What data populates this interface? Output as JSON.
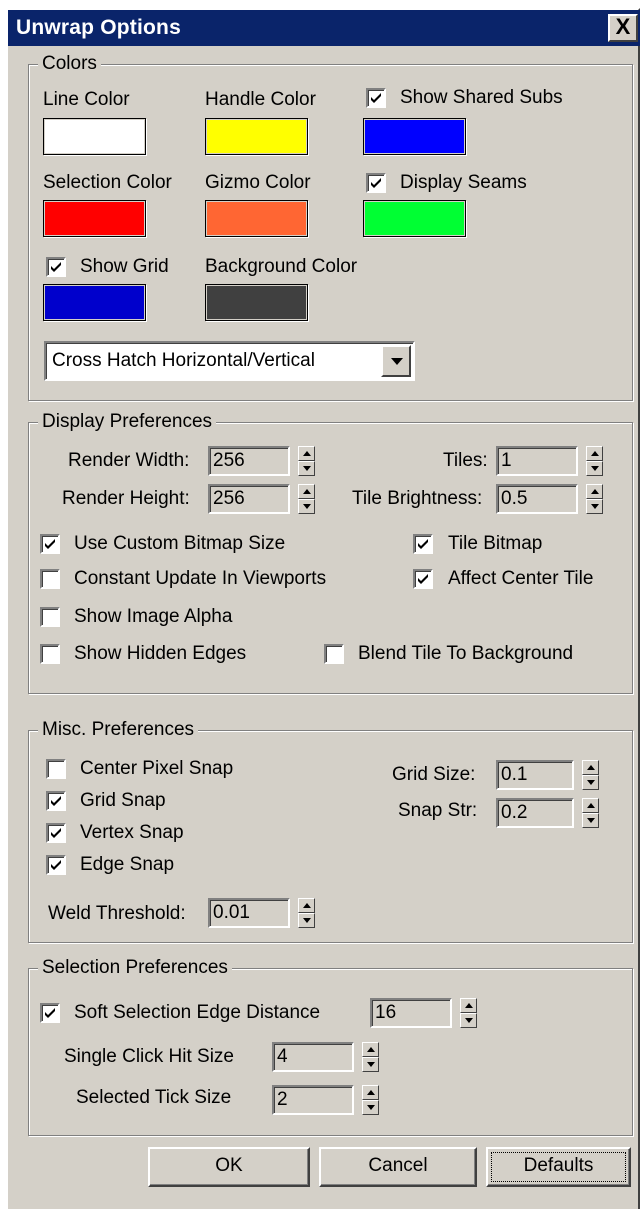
{
  "window": {
    "title": "Unwrap Options",
    "close_glyph": "X"
  },
  "colors": {
    "legend": "Colors",
    "line_color": {
      "label": "Line Color",
      "value": "#ffffff"
    },
    "handle_color": {
      "label": "Handle Color",
      "value": "#ffff00"
    },
    "show_shared_subs": {
      "label": "Show Shared Subs",
      "checked": true,
      "color": "#0000ff"
    },
    "selection_color": {
      "label": "Selection Color",
      "value": "#ff0000"
    },
    "gizmo_color": {
      "label": "Gizmo Color",
      "value": "#ff6633"
    },
    "display_seams": {
      "label": "Display Seams",
      "checked": true,
      "color": "#00ff33"
    },
    "show_grid": {
      "label": "Show Grid",
      "checked": true,
      "color": "#0000cc"
    },
    "background_color": {
      "label": "Background Color",
      "value": "#404040"
    },
    "fill_mode": {
      "value": "Cross Hatch Horizontal/Vertical"
    }
  },
  "display_preferences": {
    "legend": "Display Preferences",
    "render_width": {
      "label": "Render Width:",
      "value": "256"
    },
    "render_height": {
      "label": "Render Height:",
      "value": "256"
    },
    "tiles": {
      "label": "Tiles:",
      "value": "1"
    },
    "tile_brightness": {
      "label": "Tile Brightness:",
      "value": "0.5"
    },
    "use_custom_bitmap_size": {
      "label": "Use Custom Bitmap Size",
      "checked": true
    },
    "constant_update": {
      "label": "Constant Update In Viewports",
      "checked": false
    },
    "show_image_alpha": {
      "label": "Show Image Alpha",
      "checked": false
    },
    "show_hidden_edges": {
      "label": "Show Hidden Edges",
      "checked": false
    },
    "tile_bitmap": {
      "label": "Tile Bitmap",
      "checked": true
    },
    "affect_center_tile": {
      "label": "Affect Center Tile",
      "checked": true
    },
    "blend_tile": {
      "label": "Blend Tile To Background",
      "checked": false
    }
  },
  "misc_preferences": {
    "legend": "Misc. Preferences",
    "center_pixel_snap": {
      "label": "Center Pixel Snap",
      "checked": false
    },
    "grid_snap": {
      "label": "Grid Snap",
      "checked": true
    },
    "vertex_snap": {
      "label": "Vertex Snap",
      "checked": true
    },
    "edge_snap": {
      "label": "Edge Snap",
      "checked": true
    },
    "grid_size": {
      "label": "Grid Size:",
      "value": "0.1"
    },
    "snap_str": {
      "label": "Snap Str:",
      "value": "0.2"
    },
    "weld_threshold": {
      "label": "Weld Threshold:",
      "value": "0.01"
    }
  },
  "selection_preferences": {
    "legend": "Selection Preferences",
    "soft_selection": {
      "label": "Soft Selection Edge Distance",
      "checked": true,
      "value": "16"
    },
    "single_click_hit_size": {
      "label": "Single Click Hit Size",
      "value": "4"
    },
    "selected_tick_size": {
      "label": "Selected Tick Size",
      "value": "2"
    }
  },
  "buttons": {
    "ok": "OK",
    "cancel": "Cancel",
    "defaults": "Defaults"
  }
}
